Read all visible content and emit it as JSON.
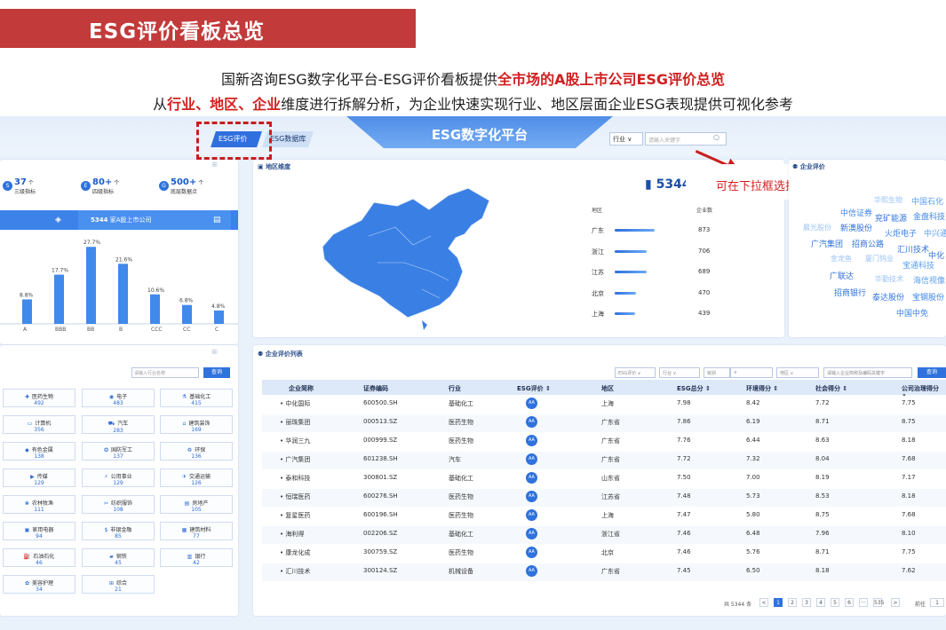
{
  "slide": {
    "title": "ESG评价看板总览",
    "line1": {
      "a": "国新咨询ESG数字化平台-ESG评价看板提供",
      "b": "全市场的A股上市公司ESG评价总览"
    },
    "line2": {
      "a": "从",
      "b": "行业、地区、企业",
      "c": "维度进行拆解分析，为企业快速实现行业、地区层面企业ESG表现提供可视化参考"
    }
  },
  "nav": {
    "title": "ESG数字化平台",
    "tabs": [
      "ESG评价",
      "ESG数据库"
    ],
    "industry_select": "行业 ∨",
    "search_placeholder": "请输入关键字"
  },
  "stats": [
    {
      "value": "37",
      "unit": "个",
      "label": "三级指标",
      "icon": "S"
    },
    {
      "value": "80+",
      "unit": "个",
      "label": "四级指标",
      "icon": "E"
    },
    {
      "value": "500+",
      "unit": "个",
      "label": "底层数据点",
      "icon": "G"
    }
  ],
  "summary_bar": {
    "count": "5344",
    "text": "家A股上市公司"
  },
  "chart_data": {
    "type": "bar",
    "categories": [
      "A",
      "BBB",
      "BB",
      "B",
      "CCC",
      "CC",
      "C"
    ],
    "values": [
      8.8,
      17.7,
      27.7,
      21.6,
      10.6,
      6.8,
      4.8
    ],
    "value_labels": [
      "8.8%",
      "17.7%",
      "27.7%",
      "21.6%",
      "10.6%",
      "6.8%",
      "4.8%"
    ],
    "ylim": [
      0,
      30
    ]
  },
  "industry_panel": {
    "search_placeholder": "请输入行业名称",
    "search_btn": "查询",
    "items": [
      {
        "name": "医药生物",
        "count": "492",
        "icon": "✚"
      },
      {
        "name": "电子",
        "count": "483",
        "icon": "◉"
      },
      {
        "name": "基础化工",
        "count": "415",
        "icon": "⚗"
      },
      {
        "name": "计算机",
        "count": "356",
        "icon": "▭"
      },
      {
        "name": "汽车",
        "count": "283",
        "icon": "⛟"
      },
      {
        "name": "建筑装饰",
        "count": "169",
        "icon": "⌂"
      },
      {
        "name": "有色金属",
        "count": "138",
        "icon": "◆"
      },
      {
        "name": "国防军工",
        "count": "137",
        "icon": "✪"
      },
      {
        "name": "环保",
        "count": "136",
        "icon": "♻"
      },
      {
        "name": "传媒",
        "count": "129",
        "icon": "▶"
      },
      {
        "name": "公用事业",
        "count": "129",
        "icon": "⚡"
      },
      {
        "name": "交通运输",
        "count": "126",
        "icon": "✈"
      },
      {
        "name": "农林牧渔",
        "count": "111",
        "icon": "❀"
      },
      {
        "name": "纺织服饰",
        "count": "108",
        "icon": "✂"
      },
      {
        "name": "房地产",
        "count": "105",
        "icon": "▤"
      },
      {
        "name": "家用电器",
        "count": "94",
        "icon": "▣"
      },
      {
        "name": "非银金融",
        "count": "85",
        "icon": "$"
      },
      {
        "name": "建筑材料",
        "count": "77",
        "icon": "▦"
      },
      {
        "name": "石油石化",
        "count": "46",
        "icon": "⛽"
      },
      {
        "name": "钢铁",
        "count": "45",
        "icon": "▰"
      },
      {
        "name": "银行",
        "count": "42",
        "icon": "▥"
      },
      {
        "name": "美容护理",
        "count": "34",
        "icon": "✿"
      },
      {
        "name": "综合",
        "count": "21",
        "icon": "⊞"
      }
    ]
  },
  "region_panel": {
    "title": "地区维度",
    "total": "5344",
    "total_suffix": "家",
    "head_region": "地区",
    "head_count": "企业数",
    "rows": [
      {
        "name": "广东",
        "count": "873",
        "fill": 1.0
      },
      {
        "name": "浙江",
        "count": "706",
        "fill": 0.81
      },
      {
        "name": "江苏",
        "count": "689",
        "fill": 0.79
      },
      {
        "name": "北京",
        "count": "470",
        "fill": 0.54
      },
      {
        "name": "上海",
        "count": "439",
        "fill": 0.5
      }
    ]
  },
  "callout": "可在下拉框选择按行业、企业搜索，跳转",
  "company_panel": {
    "title": "企业评价",
    "words": [
      "华熙生物",
      "中国石化",
      "中信证券",
      "兖矿能源",
      "金盘科技",
      "晨光股份",
      "新澳股份",
      "火炬电子",
      "中兴通",
      "广汽集团",
      "招商公路",
      "汇川技术",
      "中化",
      "金龙鱼",
      "厦门钨业",
      "宝通科技",
      "广联达",
      "华勤技术",
      "海信视像",
      "招商银行",
      "泰达股份",
      "宝钢股份",
      "中国中免"
    ]
  },
  "table": {
    "title": "企业评价列表",
    "filters": [
      "ESG评价 ∨",
      "行业 ∨",
      "级别",
      "∨",
      "地区 ∨"
    ],
    "search_placeholder": "请输入企业简称及编码关键字",
    "search_btn": "查询",
    "headers": [
      "企业简称",
      "证券编码",
      "行业",
      "ESG评价 ⇕",
      "地区",
      "ESG总分 ⇕",
      "环境得分 ⇕",
      "社会得分 ⇕",
      "公司治理得分 ⇕"
    ],
    "rows": [
      [
        "中化国际",
        "600500.SH",
        "基础化工",
        "AA",
        "上海",
        "7.98",
        "8.42",
        "7.72",
        "7.75"
      ],
      [
        "丽珠集团",
        "000513.SZ",
        "医药生物",
        "AA",
        "广东省",
        "7.86",
        "6.19",
        "8.71",
        "8.75"
      ],
      [
        "华润三九",
        "000999.SZ",
        "医药生物",
        "AA",
        "广东省",
        "7.76",
        "6.44",
        "8.63",
        "8.18"
      ],
      [
        "广汽集团",
        "601238.SH",
        "汽车",
        "AA",
        "广东省",
        "7.72",
        "7.32",
        "8.04",
        "7.68"
      ],
      [
        "泰和科技",
        "300801.SZ",
        "基础化工",
        "AA",
        "山东省",
        "7.50",
        "7.00",
        "8.19",
        "7.17"
      ],
      [
        "恒瑞医药",
        "600276.SH",
        "医药生物",
        "AA",
        "江苏省",
        "7.48",
        "5.73",
        "8.53",
        "8.18"
      ],
      [
        "复星医药",
        "600196.SH",
        "医药生物",
        "AA",
        "上海",
        "7.47",
        "5.80",
        "8.75",
        "7.68"
      ],
      [
        "海利得",
        "002206.SZ",
        "基础化工",
        "AA",
        "浙江省",
        "7.46",
        "6.48",
        "7.96",
        "8.10"
      ],
      [
        "康龙化成",
        "300759.SZ",
        "医药生物",
        "AA",
        "北京",
        "7.46",
        "5.76",
        "8.71",
        "7.75"
      ],
      [
        "汇川技术",
        "300124.SZ",
        "机械设备",
        "AA",
        "广东省",
        "7.45",
        "6.50",
        "8.18",
        "7.62"
      ]
    ],
    "pager": {
      "total": "共 5344 条",
      "prev": "<",
      "pages": [
        "1",
        "2",
        "3",
        "4",
        "5",
        "6",
        "···",
        "535"
      ],
      "next": ">",
      "goto": "前往",
      "goto_value": "1"
    }
  }
}
